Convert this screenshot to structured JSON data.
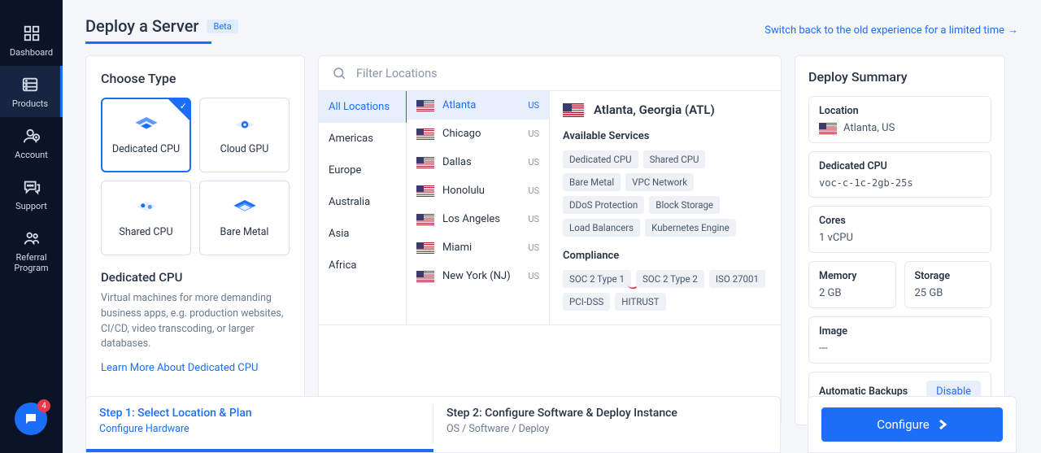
{
  "sidebar": {
    "items": [
      {
        "label": "Dashboard"
      },
      {
        "label": "Products"
      },
      {
        "label": "Account"
      },
      {
        "label": "Support"
      },
      {
        "label": "Referral Program"
      }
    ],
    "chat_badge": "4"
  },
  "header": {
    "title": "Deploy a Server",
    "beta": "Beta",
    "switch_back": "Switch back to the old experience for a limited time",
    "arrow": "→"
  },
  "choose": {
    "title": "Choose Type",
    "types": [
      {
        "label": "Dedicated CPU"
      },
      {
        "label": "Cloud GPU"
      },
      {
        "label": "Shared CPU"
      },
      {
        "label": "Bare Metal"
      }
    ],
    "selected_title": "Dedicated CPU",
    "selected_desc": "Virtual machines for more demanding business apps, e.g. production websites, CI/CD, video transcoding, or larger databases.",
    "learn_more": "Learn More About Dedicated CPU"
  },
  "locations": {
    "filter_placeholder": "Filter Locations",
    "regions": [
      "All Locations",
      "Americas",
      "Europe",
      "Australia",
      "Asia",
      "Africa"
    ],
    "cities": [
      {
        "name": "Atlanta",
        "cc": "US"
      },
      {
        "name": "Chicago",
        "cc": "US"
      },
      {
        "name": "Dallas",
        "cc": "US"
      },
      {
        "name": "Honolulu",
        "cc": "US"
      },
      {
        "name": "Los Angeles",
        "cc": "US"
      },
      {
        "name": "Miami",
        "cc": "US"
      },
      {
        "name": "New York (NJ)",
        "cc": "US"
      }
    ],
    "detail": {
      "title": "Atlanta, Georgia (ATL)",
      "services_heading": "Available Services",
      "services": [
        "Dedicated CPU",
        "Shared CPU",
        "Bare Metal",
        "VPC Network",
        "DDoS Protection",
        "Block Storage",
        "Load Balancers",
        "Kubernetes Engine"
      ],
      "compliance_heading": "Compliance",
      "compliance": [
        "SOC 2 Type 1",
        "SOC 2 Type 2",
        "ISO 27001",
        "PCI-DSS",
        "HITRUST"
      ]
    }
  },
  "summary": {
    "title": "Deploy Summary",
    "location_label": "Location",
    "location_value": "Atlanta, US",
    "product_label": "Dedicated CPU",
    "product_value": "voc-c-1c-2gb-25s",
    "cores_label": "Cores",
    "cores_value": "1 vCPU",
    "memory_label": "Memory",
    "memory_value": "2 GB",
    "storage_label": "Storage",
    "storage_value": "25 GB",
    "image_label": "Image",
    "image_value": "---",
    "backups_label": "Automatic Backups",
    "disable": "Disable"
  },
  "steps": {
    "step1_title": "Step 1: Select Location & Plan",
    "step1_sub": "Configure Hardware",
    "step2_title": "Step 2: Configure Software & Deploy Instance",
    "step2_sub": "OS / Software / Deploy",
    "configure": "Configure"
  }
}
